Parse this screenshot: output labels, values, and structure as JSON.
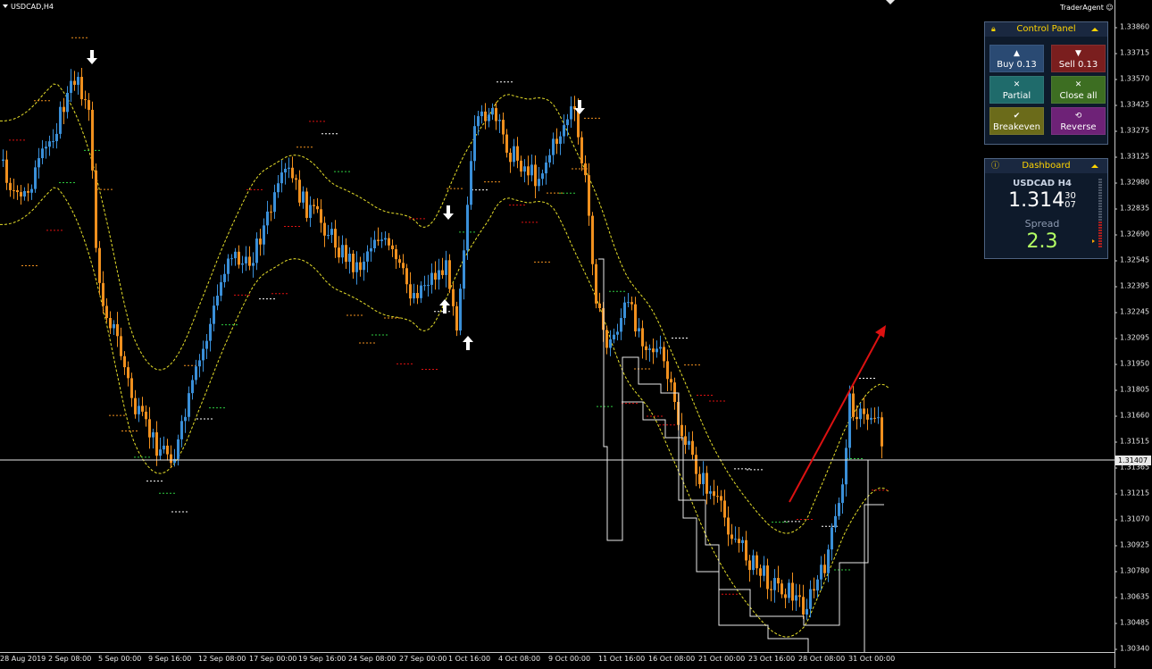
{
  "window": {
    "symbol_label": "USDCAD,H4",
    "brand": "TraderAgent"
  },
  "price_axis": {
    "ticks": [
      "1.33860",
      "1.33715",
      "1.33570",
      "1.33425",
      "1.33275",
      "1.33125",
      "1.32980",
      "1.32835",
      "1.32690",
      "1.32545",
      "1.32395",
      "1.32245",
      "1.32095",
      "1.31950",
      "1.31805",
      "1.31660",
      "1.31515",
      "1.31365",
      "1.31215",
      "1.31070",
      "1.30925",
      "1.30780",
      "1.30635",
      "1.30485",
      "1.30340"
    ],
    "current_price": "1.31407"
  },
  "time_axis": {
    "ticks": [
      "28 Aug 2019",
      "2 Sep 08:00",
      "5 Sep 00:00",
      "9 Sep 16:00",
      "12 Sep 08:00",
      "17 Sep 00:00",
      "19 Sep 16:00",
      "24 Sep 08:00",
      "27 Sep 00:00",
      "1 Oct 16:00",
      "4 Oct 08:00",
      "9 Oct 00:00",
      "11 Oct 16:00",
      "16 Oct 08:00",
      "21 Oct 00:00",
      "23 Oct 16:00",
      "28 Oct 08:00",
      "31 Oct 00:00"
    ]
  },
  "control_panel": {
    "title": "Control Panel",
    "icon": "lock-icon",
    "buttons": {
      "buy": {
        "label": "Buy 0.13",
        "icon": "arrow-up-icon",
        "color": "#2a4a73"
      },
      "sell": {
        "label": "Sell 0.13",
        "icon": "arrow-down-icon",
        "color": "#7a1e1e"
      },
      "partial": {
        "label": "Partial",
        "icon": "x-icon",
        "color": "#1f6b6b"
      },
      "close_all": {
        "label": "Close all",
        "icon": "x-icon",
        "color": "#3d6e22"
      },
      "breakeven": {
        "label": "Breakeven",
        "icon": "check-icon",
        "color": "#6b6b1a"
      },
      "reverse": {
        "label": "Reverse",
        "icon": "reverse-icon",
        "color": "#6e2277"
      }
    }
  },
  "dashboard": {
    "title": "Dashboard",
    "icon": "info-icon",
    "symbol": "USDCAD H4",
    "price_main": "1.314",
    "price_sup": "30",
    "price_sub": "07",
    "spread_label": "Spread",
    "spread_value": "2.3"
  },
  "colors": {
    "bull_candle": "#3a8fd8",
    "bear_candle": "#f0901e",
    "envelope": "#e8e02a",
    "trend_arrow": "#dd1111",
    "price_line": "#e8e8e8"
  }
}
